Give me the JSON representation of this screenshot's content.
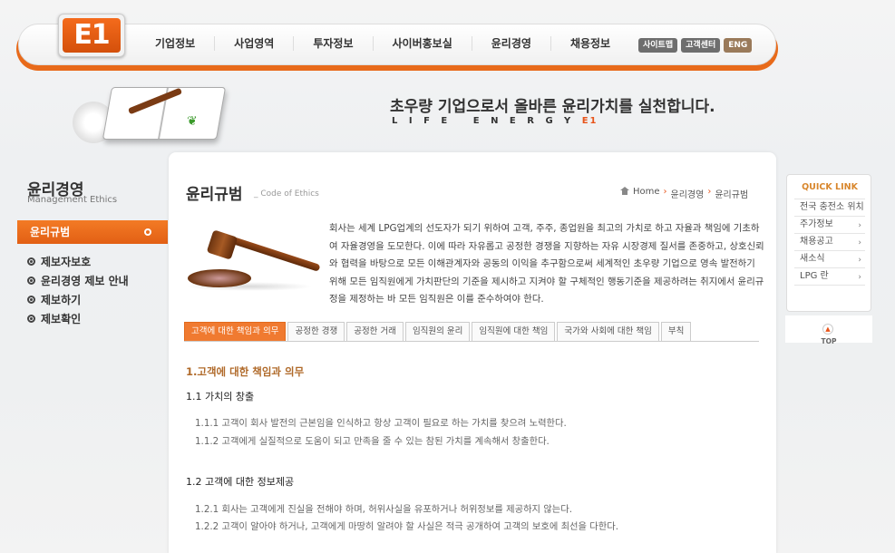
{
  "header": {
    "logo_text": "E1",
    "nav": [
      "기업정보",
      "사업영역",
      "투자정보",
      "사이버홍보실",
      "윤리경영",
      "채용정보"
    ],
    "util": [
      "사이트맵",
      "고객센터",
      "ENG"
    ],
    "colors": {
      "brand": "#e8541a",
      "accent": "#f07a30"
    }
  },
  "banner": {
    "slogan": "초우량 기업으로서 올바른 윤리가치를 실천합니다.",
    "tagline": "LIFE ENERGY",
    "tagline_brand": "E1"
  },
  "sidebar": {
    "title": "윤리경영",
    "subtitle": "Management Ethics",
    "active": "윤리규범",
    "items": [
      "제보자보호",
      "윤리경영 제보 안내",
      "제보하기",
      "제보확인"
    ]
  },
  "content": {
    "title": "윤리규범",
    "title_en": "_ Code of Ethics",
    "breadcrumb": [
      "Home",
      "윤리경영",
      "윤리규범"
    ],
    "intro": "회사는 세계 LPG업계의 선도자가 되기 위하여 고객, 주주, 종업원을 최고의 가치로 하고 자율과 책임에 기초하여 자율경영을 도모한다. 이에 따라 자유롭고 공정한 경쟁을 지향하는 자유 시장경제 질서를 존중하고, 상호신뢰와 협력을 바탕으로 모든 이해관계자와 공동의 이익을 추구함으로써 세계적인 초우량 기업으로 영속 발전하기 위해 모든 임직원에게 가치판단의 기준을 제시하고 지켜야 할 구체적인 행동기준을 제공하려는 취지에서 윤리규정을 제정하는 바 모든 임직원은 이를 준수하여야 한다.",
    "tabs": [
      "고객에 대한 책임과 의무",
      "공정한 경쟁",
      "공정한 거래",
      "임직원의 윤리",
      "임직원에 대한 책임",
      "국가와 사회에 대한 책임",
      "부칙"
    ],
    "section_title": "1.고객에 대한 책임과 의무",
    "sub1_title": "1.1 가치의 창출",
    "sub1_items": [
      "1.1.1 고객이 회사 발전의 근본임을 인식하고 항상 고객이 필요로 하는 가치를 찾으려 노력한다.",
      "1.1.2 고객에게 실질적으로 도움이 되고 만족을 줄 수 있는 참된 가치를 계속해서 창출한다."
    ],
    "sub2_title": "1.2 고객에 대한 정보제공",
    "sub2_items": [
      "1.2.1 회사는 고객에게 진실을 전해야 하며, 허위사실을 유포하거나 허위정보를 제공하지 않는다.",
      "1.2.2 고객이 알아야 하거나, 고객에게 마땅히 알려야 할 사실은 적극 공개하여 고객의 보호에 최선을 다한다."
    ]
  },
  "quick_link": {
    "title": "QUICK LINK",
    "items": [
      "전국 충전소 위치",
      "주가정보",
      "채용공고",
      "새소식",
      "LPG 란"
    ],
    "top_label": "TOP"
  }
}
